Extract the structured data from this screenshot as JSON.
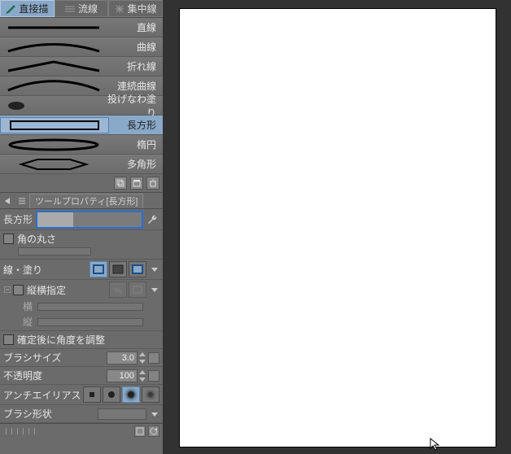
{
  "tabs": [
    {
      "id": "direct",
      "label": "直接描",
      "active": true
    },
    {
      "id": "flow",
      "label": "流線",
      "active": false
    },
    {
      "id": "focus",
      "label": "集中線",
      "active": false
    }
  ],
  "tools": [
    {
      "id": "line",
      "label": "直線",
      "preview": "line"
    },
    {
      "id": "curve",
      "label": "曲線",
      "preview": "curve"
    },
    {
      "id": "polyline",
      "label": "折れ線",
      "preview": "polyline"
    },
    {
      "id": "contcurve",
      "label": "連続曲線",
      "preview": "smooth"
    },
    {
      "id": "lasso",
      "label": "投げなわ塗り",
      "preview": "blob"
    },
    {
      "id": "rect",
      "label": "長方形",
      "preview": "rect",
      "selected": true
    },
    {
      "id": "ellipse",
      "label": "楕円",
      "preview": "ellipse"
    },
    {
      "id": "polygon",
      "label": "多角形",
      "preview": "hex"
    }
  ],
  "subtool_icons": [
    "copy-icon",
    "group-icon",
    "trash-icon"
  ],
  "tool_property_header": {
    "arrow_label": "◁",
    "tab_label": "ツールプロパティ[長方形]"
  },
  "shape_mode": {
    "label": "長方形"
  },
  "props": {
    "round_corner": {
      "label": "角の丸さ"
    },
    "line_fill": {
      "label": "線・塗り",
      "active_index": 0
    },
    "aspect": {
      "label": "縦横指定",
      "width_label": "横",
      "height_label": "縦"
    },
    "angle_after_confirm": {
      "label": "確定後に角度を調整"
    },
    "brush_size": {
      "label": "ブラシサイズ",
      "value": "3.0"
    },
    "opacity": {
      "label": "不透明度",
      "value": "100"
    },
    "antialias": {
      "label": "アンチエイリアス",
      "active_index": 2
    },
    "brush_shape": {
      "label": "ブラシ形状"
    }
  },
  "chevron": "▾",
  "updown": "÷"
}
